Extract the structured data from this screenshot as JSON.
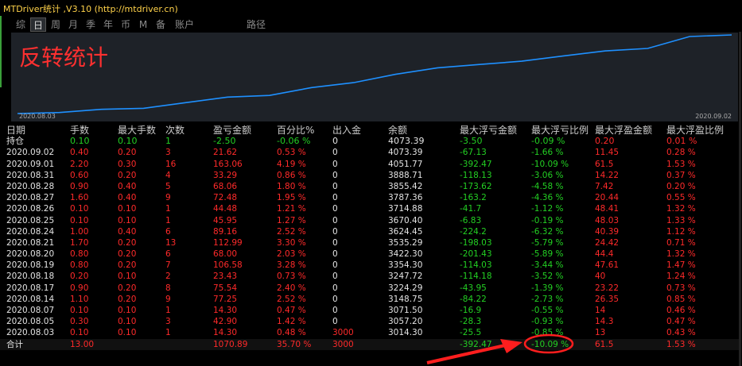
{
  "window": {
    "title": "MTDriver统计 ,V3.10 (http://mtdriver.cn)"
  },
  "tabs": [
    "综",
    "日",
    "周",
    "月",
    "季",
    "年",
    "币",
    "M",
    "备",
    "账户",
    "路径"
  ],
  "active_tab": "日",
  "chart": {
    "title": "反转统计",
    "date_start": "2020.08.03",
    "date_end": "2020.09.02"
  },
  "columns": [
    "日期",
    "手数",
    "最大手数",
    "次数",
    "盈亏金额",
    "百分比%",
    "出入金",
    "余额",
    "最大浮亏金额",
    "最大浮亏比例",
    "最大浮盈金额",
    "最大浮盈比例"
  ],
  "holding": [
    "持仓",
    "0.10",
    "0.10",
    "1",
    "-2.50",
    "-0.06 %",
    "0",
    "4073.39",
    "-3.50",
    "-0.09 %",
    "0.20",
    "0.01 %"
  ],
  "rows": [
    [
      "2020.09.02",
      "0.40",
      "0.20",
      "3",
      "21.62",
      "0.53 %",
      "0",
      "4073.39",
      "-67.13",
      "-1.66 %",
      "11.45",
      "0.28 %"
    ],
    [
      "2020.09.01",
      "2.20",
      "0.30",
      "16",
      "163.06",
      "4.19 %",
      "0",
      "4051.77",
      "-392.47",
      "-10.09 %",
      "61.5",
      "1.53 %"
    ],
    [
      "2020.08.31",
      "0.60",
      "0.20",
      "4",
      "33.29",
      "0.86 %",
      "0",
      "3888.71",
      "-118.13",
      "-3.06 %",
      "14.22",
      "0.37 %"
    ],
    [
      "2020.08.28",
      "0.90",
      "0.40",
      "5",
      "68.06",
      "1.80 %",
      "0",
      "3855.42",
      "-173.62",
      "-4.58 %",
      "7.42",
      "0.20 %"
    ],
    [
      "2020.08.27",
      "1.60",
      "0.40",
      "9",
      "72.48",
      "1.95 %",
      "0",
      "3787.36",
      "-163.2",
      "-4.36 %",
      "20.44",
      "0.55 %"
    ],
    [
      "2020.08.26",
      "0.10",
      "0.10",
      "1",
      "44.48",
      "1.21 %",
      "0",
      "3714.88",
      "-41.7",
      "-1.12 %",
      "48.41",
      "1.32 %"
    ],
    [
      "2020.08.25",
      "0.10",
      "0.10",
      "1",
      "45.95",
      "1.27 %",
      "0",
      "3670.40",
      "-6.83",
      "-0.19 %",
      "48.03",
      "1.33 %"
    ],
    [
      "2020.08.24",
      "1.00",
      "0.40",
      "6",
      "89.16",
      "2.52 %",
      "0",
      "3624.45",
      "-224.2",
      "-6.32 %",
      "40.39",
      "1.12 %"
    ],
    [
      "2020.08.21",
      "1.70",
      "0.20",
      "13",
      "112.99",
      "3.30 %",
      "0",
      "3535.29",
      "-198.03",
      "-5.79 %",
      "24.42",
      "0.71 %"
    ],
    [
      "2020.08.20",
      "0.80",
      "0.20",
      "6",
      "68.00",
      "2.03 %",
      "0",
      "3422.30",
      "-201.43",
      "-5.89 %",
      "44.4",
      "1.32 %"
    ],
    [
      "2020.08.19",
      "0.80",
      "0.20",
      "7",
      "106.58",
      "3.28 %",
      "0",
      "3354.30",
      "-114.03",
      "-3.44 %",
      "47.61",
      "1.47 %"
    ],
    [
      "2020.08.18",
      "0.20",
      "0.10",
      "2",
      "23.43",
      "0.73 %",
      "0",
      "3247.72",
      "-114.18",
      "-3.52 %",
      "40",
      "1.24 %"
    ],
    [
      "2020.08.17",
      "0.90",
      "0.20",
      "8",
      "75.54",
      "2.40 %",
      "0",
      "3224.29",
      "-43.95",
      "-1.39 %",
      "23.22",
      "0.73 %"
    ],
    [
      "2020.08.14",
      "1.10",
      "0.20",
      "9",
      "77.25",
      "2.52 %",
      "0",
      "3148.75",
      "-84.22",
      "-2.73 %",
      "26.35",
      "0.85 %"
    ],
    [
      "2020.08.07",
      "0.10",
      "0.10",
      "1",
      "14.30",
      "0.47 %",
      "0",
      "3071.50",
      "-16.9",
      "-0.55 %",
      "14",
      "0.46 %"
    ],
    [
      "2020.08.05",
      "0.30",
      "0.10",
      "3",
      "42.90",
      "1.42 %",
      "0",
      "3057.20",
      "-28.3",
      "-0.93 %",
      "14.3",
      "0.47 %"
    ],
    [
      "2020.08.03",
      "0.10",
      "0.10",
      "1",
      "14.30",
      "0.48 %",
      "3000",
      "3014.30",
      "-25.5",
      "-0.85 %",
      "13",
      "0.43 %"
    ]
  ],
  "total": [
    "合计",
    "13.00",
    "",
    "",
    "1070.89",
    "35.70 %",
    "3000",
    "",
    "-392.47",
    "-10.09 %",
    "61.5",
    "1.53 %"
  ],
  "colors": {
    "red": "#ff2a2a",
    "green": "#23d023",
    "white": "#e4e4e4",
    "curve": "#1e90ff",
    "title": "#ffd24a"
  }
}
